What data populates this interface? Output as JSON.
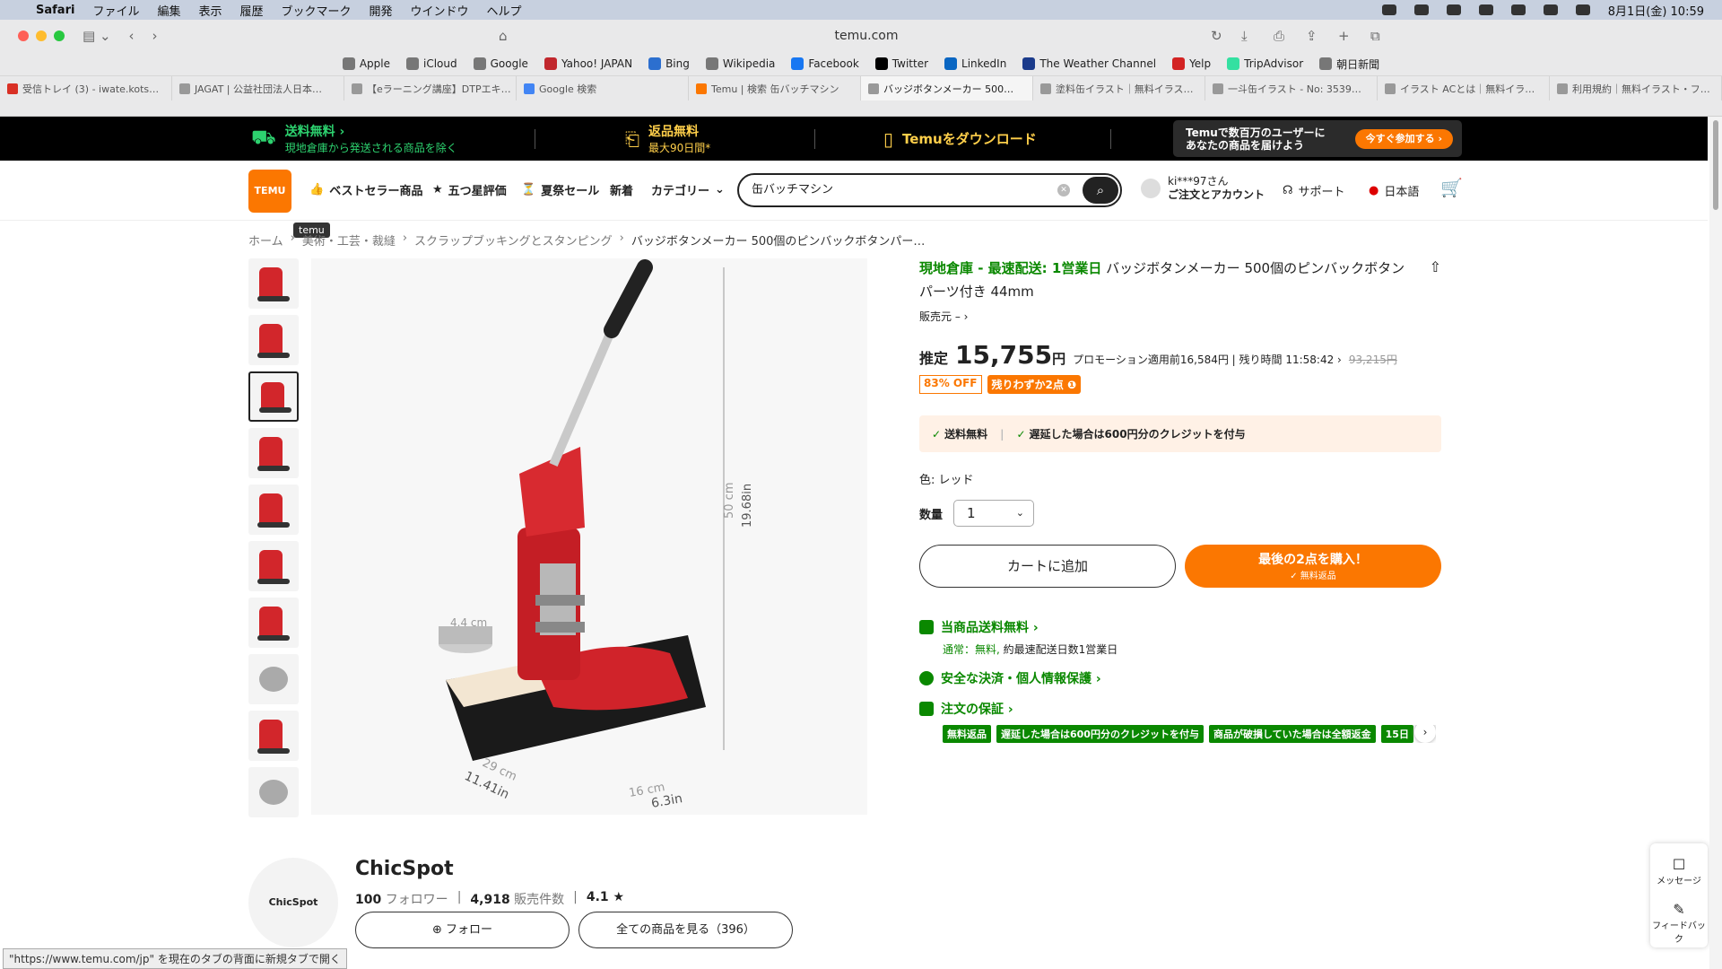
{
  "menubar": {
    "app": "Safari",
    "items": [
      "ファイル",
      "編集",
      "表示",
      "履歴",
      "ブックマーク",
      "開発",
      "ウインドウ",
      "ヘルプ"
    ],
    "datetime": "8月1日(金)  10:59"
  },
  "browser": {
    "url": "temu.com"
  },
  "favorites": [
    "Apple",
    "iCloud",
    "Google",
    "Yahoo! JAPAN",
    "Bing",
    "Wikipedia",
    "Facebook",
    "Twitter",
    "LinkedIn",
    "The Weather Channel",
    "Yelp",
    "TripAdvisor",
    "朝日新聞"
  ],
  "tabs": [
    "受信トレイ (3) - iwate.kots…",
    "JAGAT | 公益社団法人日本…",
    "【eラーニング講座】DTPエキ…",
    "Google 検索",
    "Temu | 検索 缶バッチマシン",
    "バッジボタンメーカー 500…",
    "塗料缶イラスト｜無料イラス…",
    "一斗缶イラスト - No: 3539…",
    "イラスト ACとは｜無料イラ…",
    "利用規約｜無料イラスト・フ…"
  ],
  "banner": {
    "free_ship": "送料無料 ›",
    "free_ship_sub": "現地倉庫から発送される商品を除く",
    "returns": "返品無料",
    "returns_sub": "最大90日間*",
    "download": "Temuをダウンロード",
    "promo_line1": "Temuで数百万のユーザーに",
    "promo_line2": "あなたの商品を届けよう",
    "promo_btn": "今すぐ参加する ›"
  },
  "header": {
    "logo": "TEMU",
    "nav": [
      "ベストセラー商品",
      "五つ星評価",
      "夏祭セール",
      "新着",
      "カテゴリー"
    ],
    "search_value": "缶バッチマシン",
    "account_line1": "ki***97さん",
    "account_line2": "ご注文とアカウント",
    "support": "サポート",
    "language": "日本語"
  },
  "tooltip": "temu",
  "breadcrumb": [
    "ホーム",
    "美術・工芸・裁縫",
    "スクラップブッキングとスタンピング",
    "バッジボタンメーカー 500個のピンバックボタンパー…"
  ],
  "product": {
    "fast_tag": "現地倉庫 - 最速配送: 1営業日",
    "title": "バッジボタンメーカー 500個のピンバックボタンパーツ付き 44mm",
    "seller": "販売元  – ›",
    "est": "推定",
    "price": "15,755",
    "yen": "円",
    "before": "プロモーション適用前16,584円 | 残り時間  11:58:42 ›",
    "original": "93,215円",
    "discount": "83% OFF",
    "stock": "残りわずか2点 ❶",
    "ship1": "送料無料",
    "ship2": "遅延した場合は600円分のクレジットを付与",
    "color_label": "色: レッド",
    "qty_label": "数量",
    "qty_value": "1",
    "add_cart": "カートに追加",
    "buy_main": "最後の2点を購入！",
    "buy_sub": "✓ 無料返品",
    "svc1": "当商品送料無料 ›",
    "svc1_sub_a": "通常：無料,",
    "svc1_sub_b": " 約最速配送日数1営業日",
    "svc2": "安全な決済・個人情報保護 ›",
    "svc3": "注文の保証 ›",
    "pills": [
      "無料返品",
      "遅延した場合は600円分のクレジットを付与",
      "商品が破損していた場合は全額返金",
      "15日"
    ],
    "dims": {
      "h1": "50 cm",
      "h2": "19.68in",
      "w1": "29 cm",
      "w2": "11.41in",
      "d1": "16 cm",
      "d2": "6.3in",
      "c": "4.4 cm"
    }
  },
  "store": {
    "logo": "ChicSpot",
    "name": "ChicSpot",
    "followers": "100",
    "followers_label": "フォロワー",
    "sold": "4,918",
    "sold_label": "販売件数",
    "rating": "4.1 ★",
    "follow": "フォロー",
    "all": "全ての商品を見る（396）"
  },
  "float": {
    "msg": "メッセージ",
    "fb": "フィードバック"
  },
  "status": "\"https://www.temu.com/jp\" を現在のタブの背面に新規タブで開く"
}
